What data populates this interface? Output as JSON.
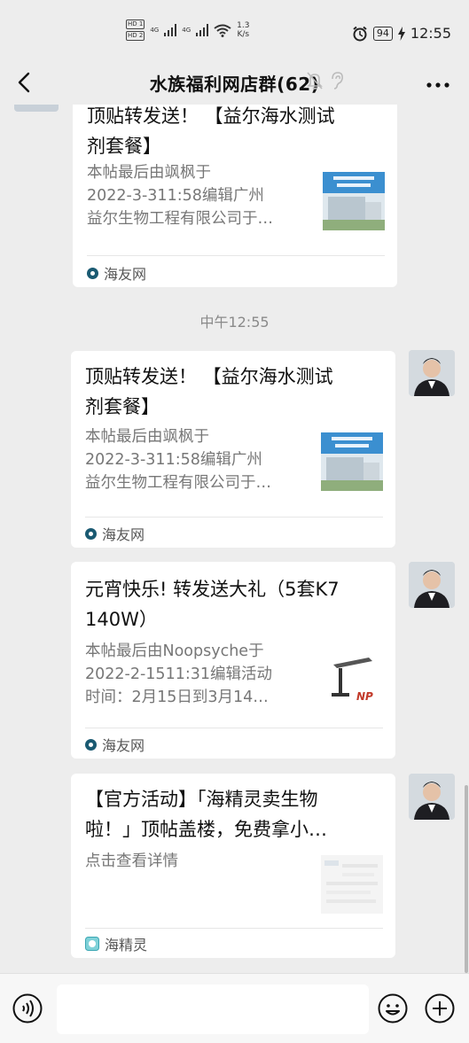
{
  "status_bar": {
    "hd1": "HD 1",
    "hd2": "HD 2",
    "net1": "4G",
    "net2": "4G",
    "speed_value": "1.3",
    "speed_unit": "K/s",
    "battery": "94",
    "time": "12:55"
  },
  "header": {
    "title": "水族福利网店群(62)"
  },
  "messages": [
    {
      "title_lines": [
        "顶贴转发送！ 【益尔海水测试",
        "剂套餐】"
      ],
      "desc_lines": [
        "本帖最后由飒枫于",
        "2022-3-311:58编辑广州",
        "益尔生物工程有限公司于…"
      ],
      "source": "海友网"
    },
    {
      "title_lines": [
        "顶贴转发送！ 【益尔海水测试",
        "剂套餐】"
      ],
      "desc_lines": [
        "本帖最后由飒枫于",
        "2022-3-311:58编辑广州",
        "益尔生物工程有限公司于…"
      ],
      "source": "海友网"
    },
    {
      "title_lines": [
        "元宵快乐! 转发送大礼（5套K7",
        "140W）"
      ],
      "desc_lines": [
        "本帖最后由Noopsyche于",
        "2022-2-1511:31编辑活动",
        "时间：2月15日到3月14…"
      ],
      "source": "海友网"
    },
    {
      "title_lines": [
        "【官方活动】「海精灵卖生物",
        "啦！」顶帖盖楼，免费拿小…"
      ],
      "desc_lines": [
        "点击查看详情"
      ],
      "source": "海精灵"
    }
  ],
  "timestamp": "中午12:55",
  "colors": {
    "background": "#ededed",
    "card": "#ffffff",
    "source_icon": "#1a5a72"
  }
}
